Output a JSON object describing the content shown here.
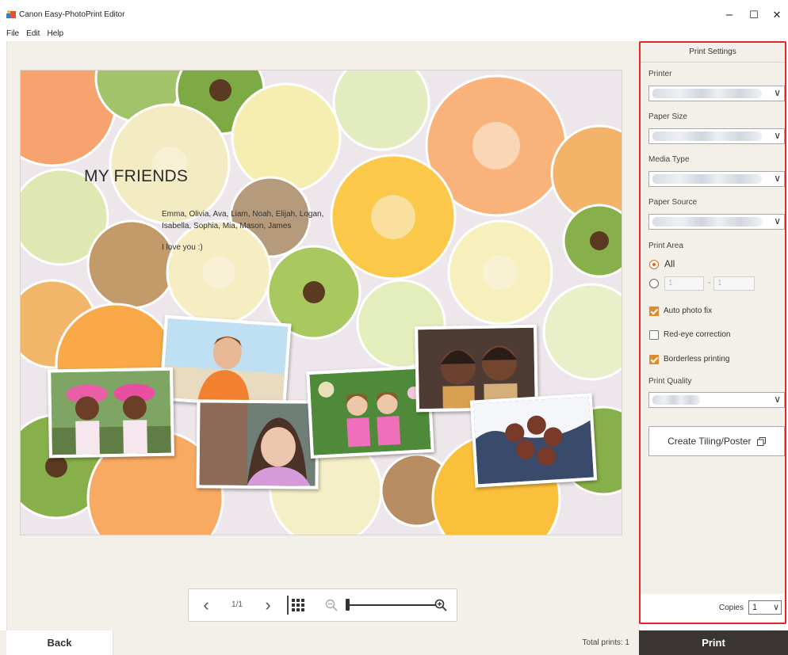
{
  "window": {
    "title": "Canon Easy-PhotoPrint Editor",
    "minimize": "–",
    "maximize": "☐",
    "close": "✕"
  },
  "menu": [
    "File",
    "Edit",
    "Help"
  ],
  "layout": {
    "title": "MY FRIENDS",
    "names": "Emma, Olivia, Ava, Liam, Noah, Elijah, Logan, Isabella, Sophia, Mia, Mason, James",
    "message": "I love you :)"
  },
  "toolbar": {
    "prev": "‹",
    "page": "1/1",
    "next": "›",
    "grid_icon": "grid-icon",
    "zoom_out_icon": "zoom-out-icon",
    "zoom_in_icon": "zoom-in-icon",
    "zoom_level": 0.0
  },
  "settings": {
    "header": "Print Settings",
    "printer_label": "Printer",
    "paper_size_label": "Paper Size",
    "media_type_label": "Media Type",
    "paper_source_label": "Paper Source",
    "print_area_label": "Print Area",
    "print_area_all": "All",
    "range_from": "1",
    "range_to": "1",
    "range_sep": "-",
    "auto_photo_fix": {
      "label": "Auto photo fix",
      "checked": true
    },
    "red_eye": {
      "label": "Red-eye correction",
      "checked": false
    },
    "borderless": {
      "label": "Borderless printing",
      "checked": true
    },
    "print_quality_label": "Print Quality",
    "tiling_button": "Create Tiling/Poster",
    "copies_label": "Copies",
    "copies_value": "1"
  },
  "footer": {
    "back": "Back",
    "total_prints": "Total prints: 1",
    "print": "Print"
  },
  "colors": {
    "highlight_border": "#e8242a",
    "print_button": "#3a3533",
    "checkbox_on": "#e08a2c"
  }
}
